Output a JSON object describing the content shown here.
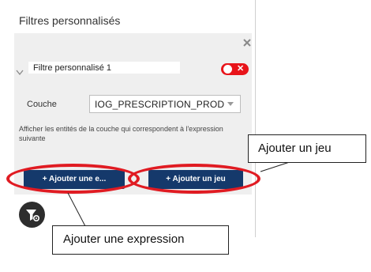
{
  "panel": {
    "title": "Filtres personnalisés"
  },
  "filter": {
    "name": "Filtre personnalisé 1",
    "enabled": false,
    "toggle_color": "#e8141a"
  },
  "layer": {
    "label": "Couche",
    "selected": "IOG_PRESCRIPTION_PROD"
  },
  "description": "Afficher les entités de la couche qui correspondent à l'expression suivante",
  "buttons": {
    "add_expression": "+ Ajouter une e...",
    "add_set": "+ Ajouter un jeu",
    "color": "#15396b"
  },
  "icons": {
    "close": "close-icon",
    "collapse": "chevron-down-icon",
    "filter_settings": "filter-settings-icon"
  },
  "annotations": {
    "highlight_color": "#e01b22",
    "callout_set": "Ajouter un jeu",
    "callout_expression": "Ajouter une expression"
  }
}
